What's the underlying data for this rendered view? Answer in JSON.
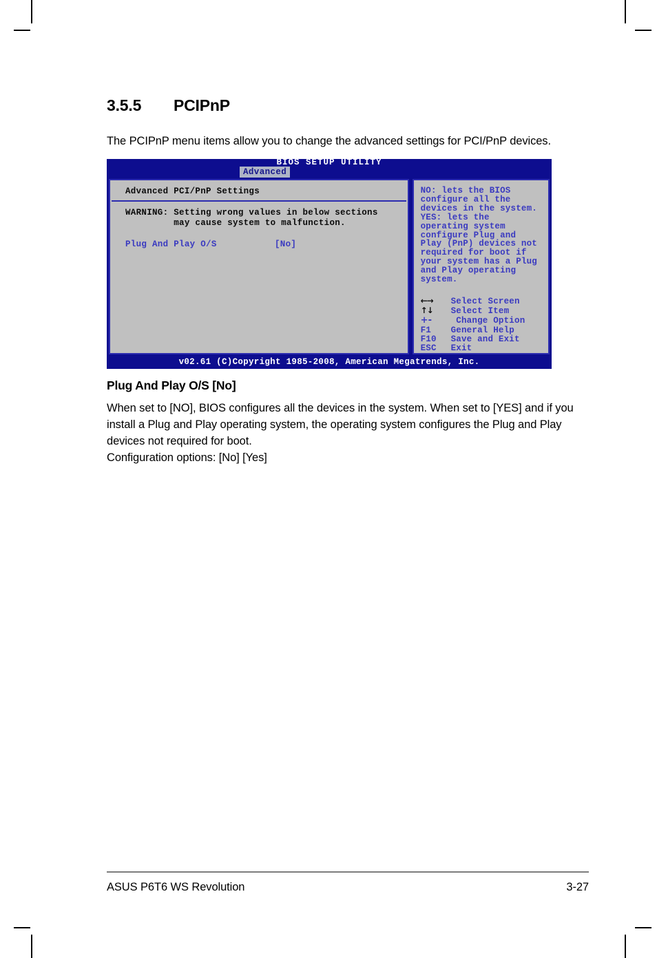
{
  "document": {
    "section_number": "3.5.5",
    "section_title": "PCIPnP",
    "intro_paragraph": "The PCIPnP menu items allow you to change the advanced settings for PCI/PnP devices.",
    "subsection_heading": "Plug And Play O/S [No]",
    "body_paragraph": "When set to [NO], BIOS configures all the devices in the system. When set to [YES] and if you install a Plug and Play operating system, the operating system configures the Plug and Play devices not required for boot.",
    "config_options_line": "Configuration options: [No] [Yes]"
  },
  "bios": {
    "title": "BIOS SETUP UTILITY",
    "active_tab": "Advanced",
    "left_panel": {
      "section_title": "Advanced PCI/PnP Settings",
      "warning_line1": "WARNING: Setting wrong values in below sections",
      "warning_line2": "         may cause system to malfunction.",
      "setting_label": "Plug And Play O/S",
      "setting_value": "[No]"
    },
    "help_panel": {
      "text": "NO: lets the BIOS\nconfigure all the\ndevices in the system.\nYES: lets the\noperating system\nconfigure Plug and\nPlay (PnP) devices not\nrequired for boot if\nyour system has a Plug\nand Play operating\nsystem."
    },
    "legend": [
      {
        "key": "←→",
        "desc": "Select Screen",
        "style": "glyph"
      },
      {
        "key": "↑↓",
        "desc": "Select Item",
        "style": "glyph"
      },
      {
        "key": "+-",
        "desc": " Change Option",
        "style": "sign"
      },
      {
        "key": "F1",
        "desc": "General Help",
        "style": "text"
      },
      {
        "key": "F10",
        "desc": "Save and Exit",
        "style": "text"
      },
      {
        "key": "ESC",
        "desc": "Exit",
        "style": "text"
      }
    ],
    "footer": "v02.61 (C)Copyright 1985-2008, American Megatrends, Inc.",
    "colors": {
      "window_blue": "#0d0d8f",
      "panel_gray": "#c0c0c0",
      "panel_border": "#2b2bb0",
      "text_blue": "#3a3ac0",
      "tab_background": "#aeb4c6"
    }
  },
  "page_footer": {
    "left": "ASUS P6T6 WS Revolution",
    "right": "3-27"
  }
}
